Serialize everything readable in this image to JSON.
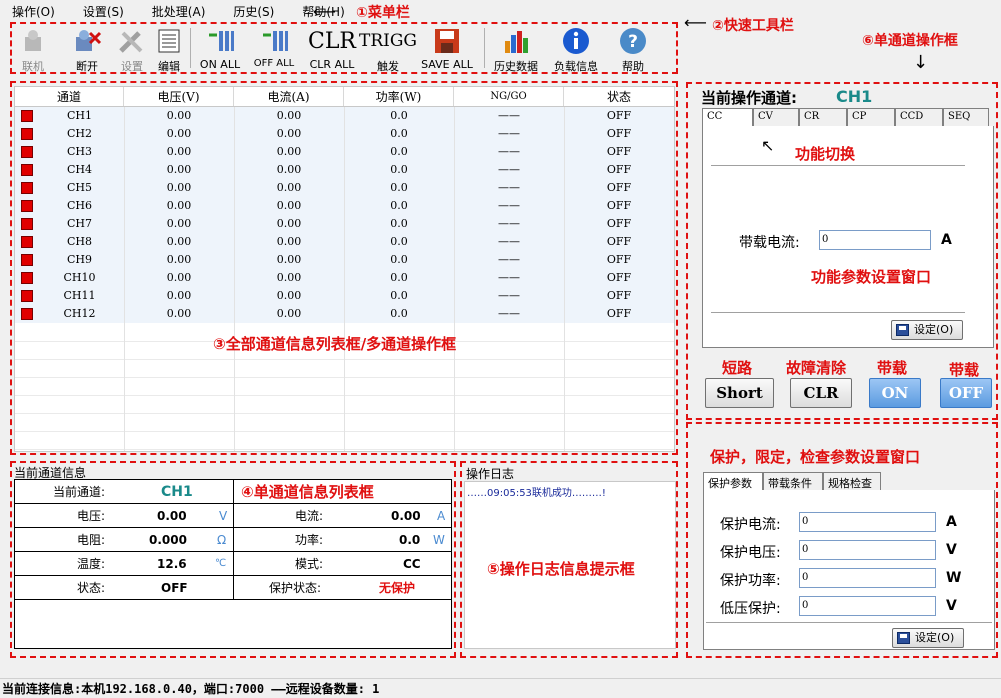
{
  "menu": {
    "items": [
      "操作(O)",
      "设置(S)",
      "批处理(A)",
      "历史(S)",
      "帮助(H)"
    ],
    "annotation": "①菜单栏"
  },
  "toolbar": {
    "annotation": "②快速工具栏",
    "connect": "联机",
    "disconnect": "断开",
    "settings": "设置",
    "edit": "编辑",
    "on_all": "ON ALL",
    "off_all": "OFF ALL",
    "clr_all": "CLR ALL",
    "clr_big": "CLR",
    "trigg": "触发",
    "trigg_big": "TRIGG",
    "save_all": "SAVE ALL",
    "history": "历史数据",
    "load_info": "负载信息",
    "help": "帮助"
  },
  "channel_table": {
    "annotation": "③全部通道信息列表框/多通道操作框",
    "headers": [
      "通道",
      "电压(V)",
      "电流(A)",
      "功率(W)",
      "NG/GO",
      "状态"
    ],
    "rows": [
      {
        "ch": "CH1",
        "v": "0.00",
        "a": "0.00",
        "w": "0.0",
        "ng": "——",
        "st": "OFF"
      },
      {
        "ch": "CH2",
        "v": "0.00",
        "a": "0.00",
        "w": "0.0",
        "ng": "——",
        "st": "OFF"
      },
      {
        "ch": "CH3",
        "v": "0.00",
        "a": "0.00",
        "w": "0.0",
        "ng": "——",
        "st": "OFF"
      },
      {
        "ch": "CH4",
        "v": "0.00",
        "a": "0.00",
        "w": "0.0",
        "ng": "——",
        "st": "OFF"
      },
      {
        "ch": "CH5",
        "v": "0.00",
        "a": "0.00",
        "w": "0.0",
        "ng": "——",
        "st": "OFF"
      },
      {
        "ch": "CH6",
        "v": "0.00",
        "a": "0.00",
        "w": "0.0",
        "ng": "——",
        "st": "OFF"
      },
      {
        "ch": "CH7",
        "v": "0.00",
        "a": "0.00",
        "w": "0.0",
        "ng": "——",
        "st": "OFF"
      },
      {
        "ch": "CH8",
        "v": "0.00",
        "a": "0.00",
        "w": "0.0",
        "ng": "——",
        "st": "OFF"
      },
      {
        "ch": "CH9",
        "v": "0.00",
        "a": "0.00",
        "w": "0.0",
        "ng": "——",
        "st": "OFF"
      },
      {
        "ch": "CH10",
        "v": "0.00",
        "a": "0.00",
        "w": "0.0",
        "ng": "——",
        "st": "OFF"
      },
      {
        "ch": "CH11",
        "v": "0.00",
        "a": "0.00",
        "w": "0.0",
        "ng": "——",
        "st": "OFF"
      },
      {
        "ch": "CH12",
        "v": "0.00",
        "a": "0.00",
        "w": "0.0",
        "ng": "——",
        "st": "OFF"
      }
    ]
  },
  "channel_info": {
    "title": "当前通道信息",
    "annotation": "④单通道信息列表框",
    "current_channel_label": "当前通道:",
    "current_channel": "CH1",
    "voltage_label": "电压:",
    "voltage": "0.00",
    "voltage_unit": "V",
    "current_label": "电流:",
    "current": "0.00",
    "current_unit": "A",
    "resistance_label": "电阻:",
    "resistance": "0.000",
    "resistance_unit": "Ω",
    "power_label": "功率:",
    "power": "0.0",
    "power_unit": "W",
    "temp_label": "温度:",
    "temp": "12.6",
    "temp_unit": "℃",
    "mode_label": "模式:",
    "mode": "CC",
    "state_label": "状态:",
    "state": "OFF",
    "protect_label": "保护状态:",
    "protect": "无保护"
  },
  "log": {
    "title": "操作日志",
    "annotation": "⑤操作日志信息提示框",
    "entries": [
      "……09:05:53联机成功………!"
    ]
  },
  "single_op": {
    "annotation": "⑥单通道操作框",
    "current_label": "当前操作通道:",
    "current_channel": "CH1",
    "tabs": [
      "CC",
      "CV",
      "CR",
      "CP",
      "CCD",
      "SEQ"
    ],
    "func_switch_note": "功能切换",
    "load_current_label": "带载电流:",
    "load_current_value": "0",
    "load_current_unit": "A",
    "param_window_note": "功能参数设置窗口",
    "set_button": "设定(O)",
    "short_note": "短路",
    "clr_note": "故障清除",
    "on_note": "带载",
    "off_note": "带载",
    "short_btn": "Short",
    "clr_btn": "CLR",
    "on_btn": "ON",
    "off_btn": "OFF"
  },
  "protect": {
    "annotation": "保护，限定，检查参数设置窗口",
    "tabs": [
      "保护参数",
      "带载条件",
      "规格检查"
    ],
    "fields": [
      {
        "label": "保护电流:",
        "value": "0",
        "unit": "A"
      },
      {
        "label": "保护电压:",
        "value": "0",
        "unit": "V"
      },
      {
        "label": "保护功率:",
        "value": "0",
        "unit": "W"
      },
      {
        "label": "低压保护:",
        "value": "0",
        "unit": "V"
      }
    ],
    "set_button": "设定(O)"
  },
  "status": {
    "text": "当前连接信息:本机192.168.0.40，端口:7000  ——远程设备数量: 1"
  },
  "colors": {
    "annotation_red": "#e01010",
    "channel_teal": "#1a8a8a",
    "on_blue": "#5b9be0",
    "row_blue": "#eef4fb"
  }
}
